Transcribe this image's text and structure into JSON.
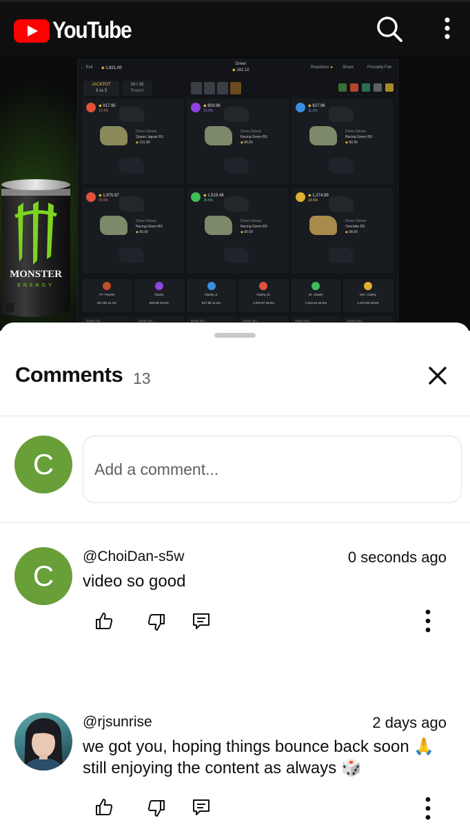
{
  "app": {
    "brand": "YouTube",
    "colors": {
      "brand_red": "#ff0000",
      "topbar_bg": "#0f0f0f",
      "avatar_green": "#689f38"
    },
    "top_icons": [
      "search-icon",
      "more-vert-icon"
    ]
  },
  "video": {
    "game": {
      "exit_label": "Exit",
      "balance": "1,821.00",
      "driver_label": "Driver",
      "driver_value": "182.10",
      "reactions_label": "Reactions",
      "share_label": "Share",
      "fair_label": "Provably Fair",
      "jackpot_label": "JACKPOT",
      "jackpot_sub": "3 vs 3",
      "round_value": "10 / 10",
      "round_label": "Round",
      "cells": [
        {
          "value": "917.95",
          "pct": "12.4%",
          "item_type": "Driver Gloves",
          "item_name": "Queen Jaguar BS",
          "item_price": "101.99",
          "color": "#e0533a"
        },
        {
          "value": "803.96",
          "pct": "10.6%",
          "item_type": "Driver Gloves",
          "item_name": "Racing Green BS",
          "item_price": "80.00",
          "color": "#8e44e0"
        },
        {
          "value": "827.98",
          "pct": "11.2%",
          "item_type": "Driver Gloves",
          "item_name": "Racing Green BS",
          "item_price": "80.00",
          "color": "#3b8fe0"
        },
        {
          "value": "1,975.97",
          "pct": "25.6%",
          "item_type": "Driver Gloves",
          "item_name": "Racing Green BS",
          "item_price": "80.00",
          "color": "#e0533a"
        },
        {
          "value": "1,519.46",
          "pct": "20.5%",
          "item_type": "Driver Gloves",
          "item_name": "Racing Green BS",
          "item_price": "80.00",
          "color": "#3fbf5a"
        },
        {
          "value": "1,374.99",
          "pct": "18.5%",
          "item_type": "Driver Gloves",
          "item_name": "Overtake BS",
          "item_price": "98.00",
          "color": "#e0b030"
        }
      ],
      "players": [
        {
          "name": "YT- PeyOR",
          "value": "917.95",
          "pct": "12.4%"
        },
        {
          "name": "Clashy",
          "value": "803.96",
          "pct": "10.6%"
        },
        {
          "name": "Clashy Jr.",
          "value": "827.98",
          "pct": "11.2%"
        },
        {
          "name": "Clashy Sr.",
          "value": "1,975.97",
          "pct": "25.6%"
        },
        {
          "name": "Dr. Clashy",
          "value": "1,519.46",
          "pct": "20.5%"
        },
        {
          "name": "Mrs. Clashy",
          "value": "1,374.99",
          "pct": "18.5%"
        }
      ],
      "strip_label": "Driver Glo..."
    },
    "can_brand": "MONSTER",
    "can_sub": "ENERGY"
  },
  "comments": {
    "title": "Comments",
    "count": "13",
    "input": {
      "placeholder": "Add a comment...",
      "avatar_letter": "C"
    },
    "items": [
      {
        "author": "@ChoiDan-s5w",
        "time": "0 seconds ago",
        "text": "video so good",
        "avatar_letter": "C"
      },
      {
        "author": "@rjsunrise",
        "time": "2 days ago",
        "text": "we got you, hoping things bounce back soon 🙏 still enjoying the content as always 🎲"
      }
    ]
  }
}
